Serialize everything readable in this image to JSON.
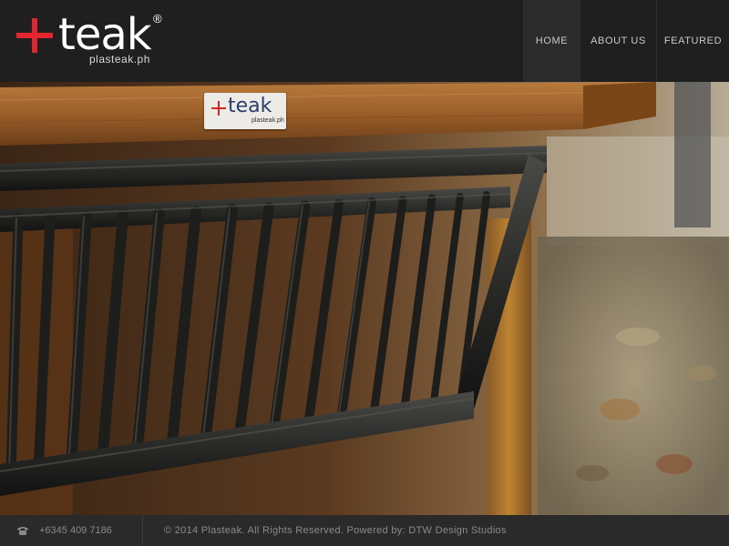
{
  "brand": {
    "name": "teak",
    "registered_mark": "®",
    "website": "plasteak.ph",
    "accent_color": "#e3262d"
  },
  "nav": {
    "items": [
      {
        "label": "HOME",
        "active": true
      },
      {
        "label": "ABOUT US",
        "active": false
      },
      {
        "label": "FEATURED",
        "active": false
      }
    ]
  },
  "hero": {
    "tag": {
      "word": "teak",
      "url": "plasteak.ph"
    }
  },
  "footer": {
    "phone_icon": "phone-icon",
    "phone": "+6345 409 7186",
    "copyright": "© 2014 Plasteak. All Rights Reserved. Powered by: DTW Design Studios"
  }
}
